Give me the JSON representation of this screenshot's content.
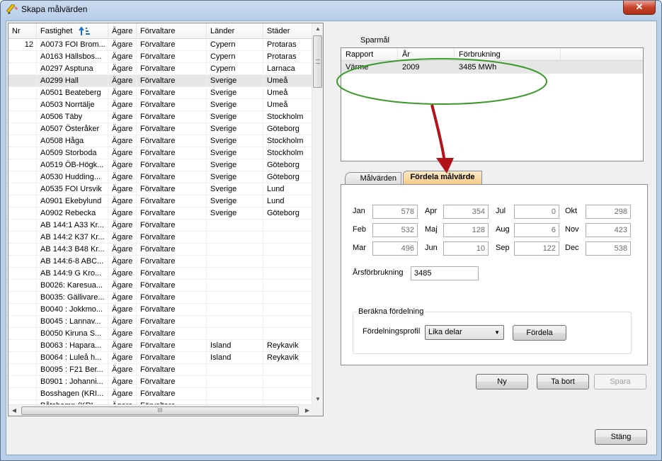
{
  "window": {
    "title": "Skapa målvärden",
    "close_symbol": "✕"
  },
  "list": {
    "columns": [
      "Nr",
      "Fastighet",
      "Ägare",
      "Förvaltare",
      "Länder",
      "Städer"
    ],
    "rows": [
      [
        "12",
        "A0073 FOI Brom...",
        "Ägare",
        "Förvaltare",
        "Cypern",
        "Protaras"
      ],
      [
        "",
        "A0163 Hällsbos...",
        "Ägare",
        "Förvaltare",
        "Cypern",
        "Protaras"
      ],
      [
        "",
        "A0297 Asptuna",
        "Ägare",
        "Förvaltare",
        "Cypern",
        "Larnaca"
      ],
      [
        "",
        "A0299 Hall",
        "Ägare",
        "Förvaltare",
        "Sverige",
        "Umeå"
      ],
      [
        "",
        "A0501 Beateberg",
        "Ägare",
        "Förvaltare",
        "Sverige",
        "Umeå"
      ],
      [
        "",
        "A0503 Norrtälje",
        "Ägare",
        "Förvaltare",
        "Sverige",
        "Umeå"
      ],
      [
        "",
        "A0506 Täby",
        "Ägare",
        "Förvaltare",
        "Sverige",
        "Stockholm"
      ],
      [
        "",
        "A0507 Österåker",
        "Ägare",
        "Förvaltare",
        "Sverige",
        "Göteborg"
      ],
      [
        "",
        "A0508 Håga",
        "Ägare",
        "Förvaltare",
        "Sverige",
        "Stockholm"
      ],
      [
        "",
        "A0509 Storboda",
        "Ägare",
        "Förvaltare",
        "Sverige",
        "Stockholm"
      ],
      [
        "",
        "A0519 ÖB-Högk...",
        "Ägare",
        "Förvaltare",
        "Sverige",
        "Göteborg"
      ],
      [
        "",
        "A0530 Hudding...",
        "Ägare",
        "Förvaltare",
        "Sverige",
        "Göteborg"
      ],
      [
        "",
        "A0535 FOI Ursvik",
        "Ägare",
        "Förvaltare",
        "Sverige",
        "Lund"
      ],
      [
        "",
        "A0901 Ekebylund",
        "Ägare",
        "Förvaltare",
        "Sverige",
        "Lund"
      ],
      [
        "",
        "A0902 Rebecka",
        "Ägare",
        "Förvaltare",
        "Sverige",
        "Göteborg"
      ],
      [
        "",
        "AB 144:1 A33 Kr...",
        "Ägare",
        "Förvaltare",
        "",
        ""
      ],
      [
        "",
        "AB 144:2 K37 Kr...",
        "Ägare",
        "Förvaltare",
        "",
        ""
      ],
      [
        "",
        "AB 144:3 B48 Kr...",
        "Ägare",
        "Förvaltare",
        "",
        ""
      ],
      [
        "",
        "AB 144:6-8 ABC...",
        "Ägare",
        "Förvaltare",
        "",
        ""
      ],
      [
        "",
        "AB 144:9 G Kro...",
        "Ägare",
        "Förvaltare",
        "",
        ""
      ],
      [
        "",
        "B0026: Karesua...",
        "Ägare",
        "Förvaltare",
        "",
        ""
      ],
      [
        "",
        "B0035: Gällivare...",
        "Ägare",
        "Förvaltare",
        "",
        ""
      ],
      [
        "",
        "B0040 : Jokkmo...",
        "Ägare",
        "Förvaltare",
        "",
        ""
      ],
      [
        "",
        "B0045 : Lannav...",
        "Ägare",
        "Förvaltare",
        "",
        ""
      ],
      [
        "",
        "B0050  Kiruna S...",
        "Ägare",
        "Förvaltare",
        "",
        ""
      ],
      [
        "",
        "B0063 : Hapara...",
        "Ägare",
        "Förvaltare",
        "Island",
        "Reykavik"
      ],
      [
        "",
        "B0064 : Luleå h...",
        "Ägare",
        "Förvaltare",
        "Island",
        "Reykavik"
      ],
      [
        "",
        "B0095 : F21 Ber...",
        "Ägare",
        "Förvaltare",
        "",
        ""
      ],
      [
        "",
        "B0901 : Johanni...",
        "Ägare",
        "Förvaltare",
        "",
        ""
      ],
      [
        "",
        "Bosshagen (KRI...",
        "Ägare",
        "Förvaltare",
        "",
        ""
      ],
      [
        "",
        "Båtshamn (KRI...",
        "Ägare",
        "Förvaltare",
        "",
        ""
      ]
    ],
    "selected_row": 3,
    "hscroll_grip": "III"
  },
  "sparmal": {
    "label": "Sparmål",
    "columns": [
      "Rapport",
      "År",
      "Förbrukning"
    ],
    "rows": [
      [
        "Värme",
        "2009",
        "3485 MWh"
      ]
    ]
  },
  "tabs": [
    "Målvärden",
    "Fördela målvärde"
  ],
  "months": [
    {
      "name": "Jan",
      "value": "578"
    },
    {
      "name": "Feb",
      "value": "532"
    },
    {
      "name": "Mar",
      "value": "496"
    },
    {
      "name": "Apr",
      "value": "354"
    },
    {
      "name": "Maj",
      "value": "128"
    },
    {
      "name": "Jun",
      "value": "10"
    },
    {
      "name": "Jul",
      "value": "0"
    },
    {
      "name": "Aug",
      "value": "6"
    },
    {
      "name": "Sep",
      "value": "122"
    },
    {
      "name": "Okt",
      "value": "298"
    },
    {
      "name": "Nov",
      "value": "423"
    },
    {
      "name": "Dec",
      "value": "538"
    }
  ],
  "arsforbrukning": {
    "label": "Årsförbrukning",
    "value": "3485"
  },
  "berakna": {
    "title": "Beräkna fördelning",
    "profile_label": "Fördelningsprofil",
    "profile_value": "Lika delar",
    "fordela_button": "Fördela"
  },
  "buttons": {
    "ny": "Ny",
    "ta_bort": "Ta bort",
    "spara": "Spara",
    "stang": "Stäng"
  },
  "annotation_colors": {
    "ellipse": "#3a9a2a",
    "arrow": "#b3121b"
  }
}
